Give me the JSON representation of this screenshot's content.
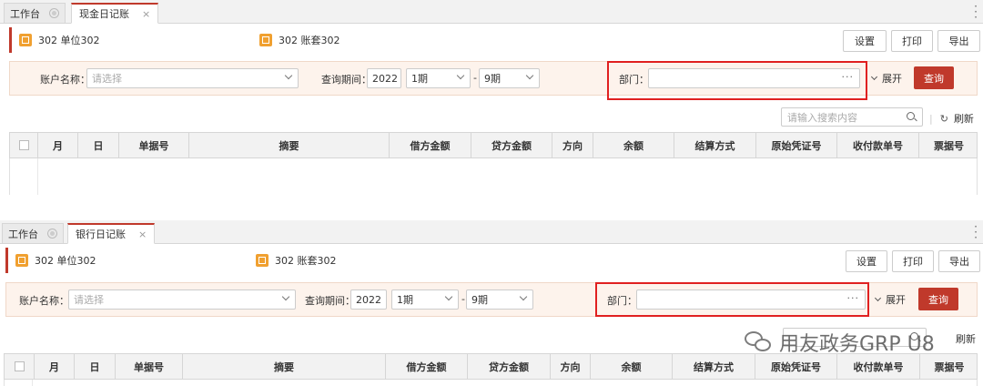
{
  "panels": [
    {
      "tabs": [
        {
          "label": "工作台",
          "active": false
        },
        {
          "label": "现金日记账",
          "active": true
        }
      ],
      "unit_label": "302 单位302",
      "book_label": "302 账套302",
      "buttons": {
        "settings": "设置",
        "print": "打印",
        "export": "导出"
      },
      "filter": {
        "account_label": "账户名称：",
        "account_placeholder": "请选择",
        "period_label": "查询期间：",
        "year": "2022",
        "period_from": "1期",
        "dash": "-",
        "period_to": "9期",
        "dept_label": "部门：",
        "dept_dots": "···",
        "expand_label": "展开",
        "query_label": "查询"
      },
      "search_placeholder": "请输入搜索内容",
      "refresh_label": "刷新",
      "columns": [
        "月",
        "日",
        "单据号",
        "摘要",
        "借方金额",
        "贷方金额",
        "方向",
        "余额",
        "结算方式",
        "原始凭证号",
        "收付款单号",
        "票据号"
      ]
    },
    {
      "tabs": [
        {
          "label": "工作台",
          "active": false
        },
        {
          "label": "银行日记账",
          "active": true
        }
      ],
      "unit_label": "302 单位302",
      "book_label": "302 账套302",
      "buttons": {
        "settings": "设置",
        "print": "打印",
        "export": "导出"
      },
      "filter": {
        "account_label": "账户名称：",
        "account_placeholder": "请选择",
        "period_label": "查询期间：",
        "year": "2022",
        "period_from": "1期",
        "dash": "-",
        "period_to": "9期",
        "dept_label": "部门：",
        "dept_dots": "···",
        "expand_label": "展开",
        "query_label": "查询"
      },
      "refresh_label": "刷新",
      "columns": [
        "月",
        "日",
        "单据号",
        "摘要",
        "借方金额",
        "贷方金额",
        "方向",
        "余额",
        "结算方式",
        "原始凭证号",
        "收付款单号",
        "票据号"
      ]
    }
  ],
  "watermark": "用友政务GRP U8",
  "colors": {
    "accent": "#c0392b",
    "icon": "#f0a030",
    "highlight": "#e02020",
    "filter_bg": "#fdf3ec"
  }
}
